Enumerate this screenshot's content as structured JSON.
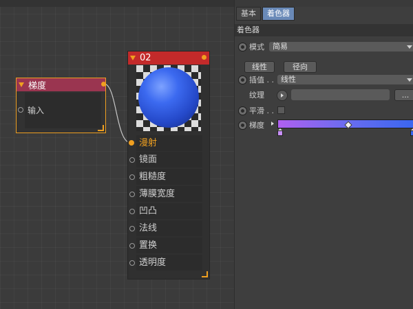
{
  "node_editor": {
    "gradient_node": {
      "title": "梯度",
      "input_label": "输入"
    },
    "material_node": {
      "title": "02",
      "inputs": [
        "漫射",
        "镜面",
        "粗糙度",
        "薄膜宽度",
        "凹凸",
        "法线",
        "置换",
        "透明度"
      ],
      "active_input": "漫射"
    }
  },
  "panel": {
    "tabs": [
      "基本",
      "着色器"
    ],
    "active_tab": "着色器",
    "section_title": "着色器",
    "mode": {
      "label": "模式",
      "value": "简易"
    },
    "buttons": {
      "linear": "线性",
      "radial": "径向"
    },
    "interpolation": {
      "label": "插值 . .",
      "value": "线性"
    },
    "texture": {
      "label": "纹理",
      "button": "..."
    },
    "smooth": {
      "label": "平滑 . .",
      "checked": false
    },
    "gradient": {
      "label": "梯度",
      "start_color": "#b060f0",
      "end_color": "#3a66f0"
    }
  },
  "colors": {
    "accent_orange": "#f0a020",
    "material_header": "#c32a2a",
    "gradient_header": "#9a3550",
    "active_tab": "#6a8ab8"
  }
}
